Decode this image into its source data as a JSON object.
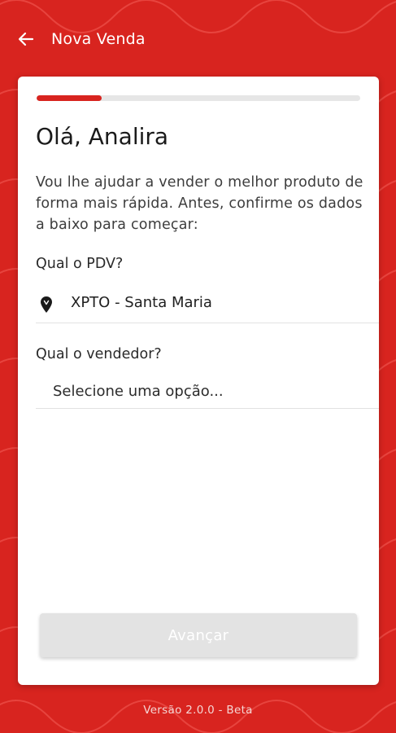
{
  "header": {
    "title": "Nova Venda",
    "back_icon": "arrow-left-icon"
  },
  "progress": {
    "value": 0.2
  },
  "card": {
    "greeting": "Olá, Analira",
    "intro": "Vou lhe ajudar a vender o melhor produto de forma mais rápida. Antes, confirme os dados a baixo para começar:",
    "pdv_label": "Qual o PDV?",
    "pdv_value": "XPTO - Santa Maria",
    "pdv_icon": "location-pin-icon",
    "vendedor_label": "Qual o vendedor?",
    "vendedor_placeholder": "Selecione uma opção...",
    "advance_label": "Avançar"
  },
  "footer": {
    "version": "Versão 2.0.0 - Beta"
  },
  "colors": {
    "brand_red": "#d8241f",
    "card_bg": "#ffffff",
    "disabled_button": "#e3e3e3"
  }
}
